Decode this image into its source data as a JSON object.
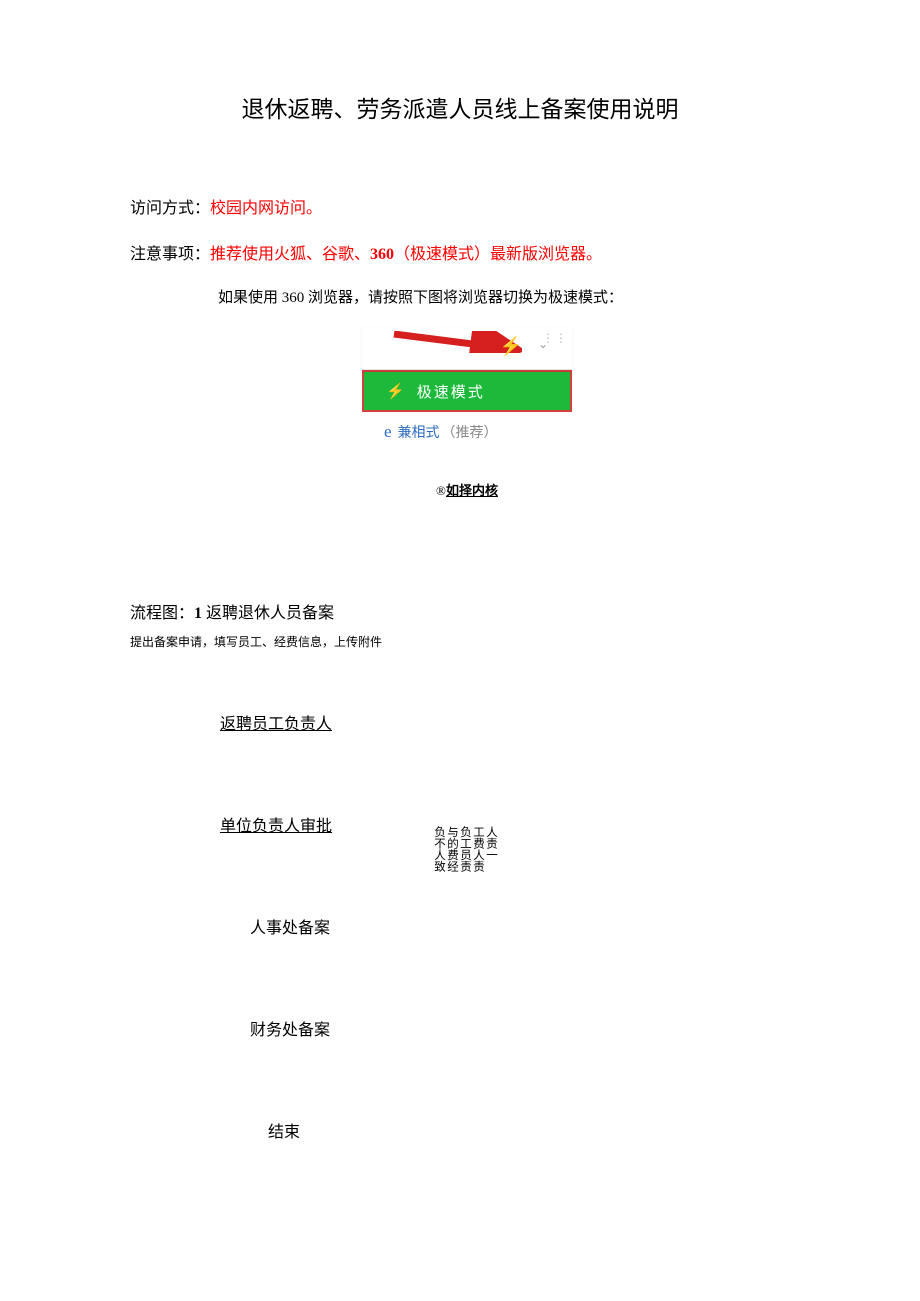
{
  "title": "退休返聘、劳务派遣人员线上备案使用说明",
  "access": {
    "label": "访问方式：",
    "value": "校园内网访问。"
  },
  "note": {
    "label": "注意事项：",
    "value_before": "推荐使用火狐、谷歌、",
    "num": "360",
    "value_after": "（极速模式）最新版浏览器。"
  },
  "sub_before": "如果使用 ",
  "sub_num": "360",
  "sub_after": " 浏览器，请按照下图将浏览器切换为极速模式：",
  "fig": {
    "fast": "极速模式",
    "compat": "兼相式",
    "compat_note": "（推荐）",
    "compat_e": "e",
    "kernel_symbol": "®",
    "kernel": "如择内核"
  },
  "flow": {
    "title_label": "流程图：",
    "title_num": "1",
    "title_rest": " 返聘退休人员备案",
    "subtitle": "提出备案申请，填写员工、经费信息，上传附件",
    "steps": [
      "返聘员工负责人",
      "单位负责人审批",
      "人事处备案",
      "财务处备案",
      "结束"
    ],
    "side_cols": [
      "负不人致",
      "与的费经",
      "负工员责",
      "工费人责",
      "人责一"
    ]
  }
}
